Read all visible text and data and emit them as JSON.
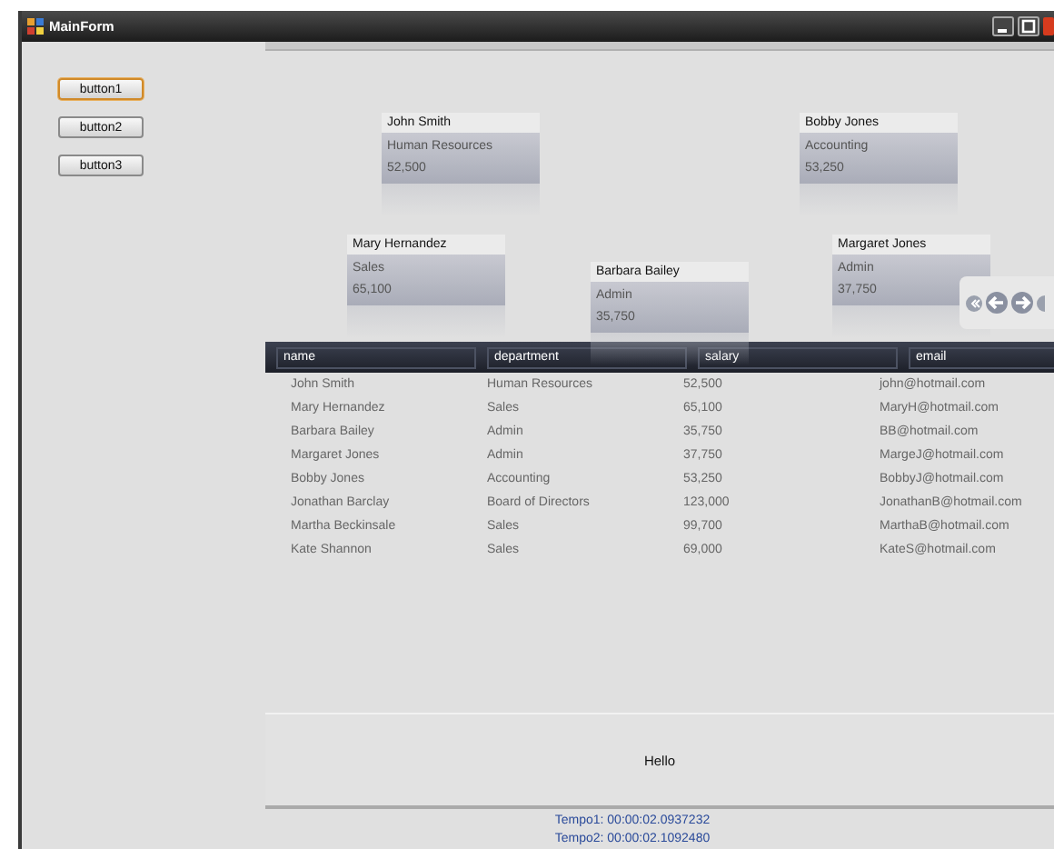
{
  "window": {
    "title": "MainForm"
  },
  "buttons": [
    {
      "label": "button1",
      "focused": true
    },
    {
      "label": "button2",
      "focused": false
    },
    {
      "label": "button3",
      "focused": false
    }
  ],
  "carousel": {
    "cards": [
      {
        "name": "John Smith",
        "department": "Human Resources",
        "salary": "52,500"
      },
      {
        "name": "Bobby Jones",
        "department": "Accounting",
        "salary": "53,250"
      },
      {
        "name": "Mary Hernandez",
        "department": "Sales",
        "salary": "65,100"
      },
      {
        "name": "Barbara Bailey",
        "department": "Admin",
        "salary": "35,750"
      },
      {
        "name": "Margaret Jones",
        "department": "Admin",
        "salary": "37,750"
      }
    ]
  },
  "table": {
    "columns": [
      "name",
      "department",
      "salary",
      "email"
    ],
    "rows": [
      [
        "John Smith",
        "Human Resources",
        "52,500",
        "john@hotmail.com"
      ],
      [
        "Mary Hernandez",
        "Sales",
        "65,100",
        "MaryH@hotmail.com"
      ],
      [
        "Barbara Bailey",
        "Admin",
        "35,750",
        "BB@hotmail.com"
      ],
      [
        "Margaret Jones",
        "Admin",
        "37,750",
        "MargeJ@hotmail.com"
      ],
      [
        "Bobby Jones",
        "Accounting",
        "53,250",
        "BobbyJ@hotmail.com"
      ],
      [
        "Jonathan Barclay",
        "Board of Directors",
        "123,000",
        "JonathanB@hotmail.com"
      ],
      [
        "Martha Beckinsale",
        "Sales",
        "99,700",
        "MarthaB@hotmail.com"
      ],
      [
        "Kate Shannon",
        "Sales",
        "69,000",
        "KateS@hotmail.com"
      ]
    ]
  },
  "message": "Hello",
  "timings": [
    "Tempo1: 00:00:02.0937232",
    "Tempo2: 00:00:02.1092480"
  ]
}
